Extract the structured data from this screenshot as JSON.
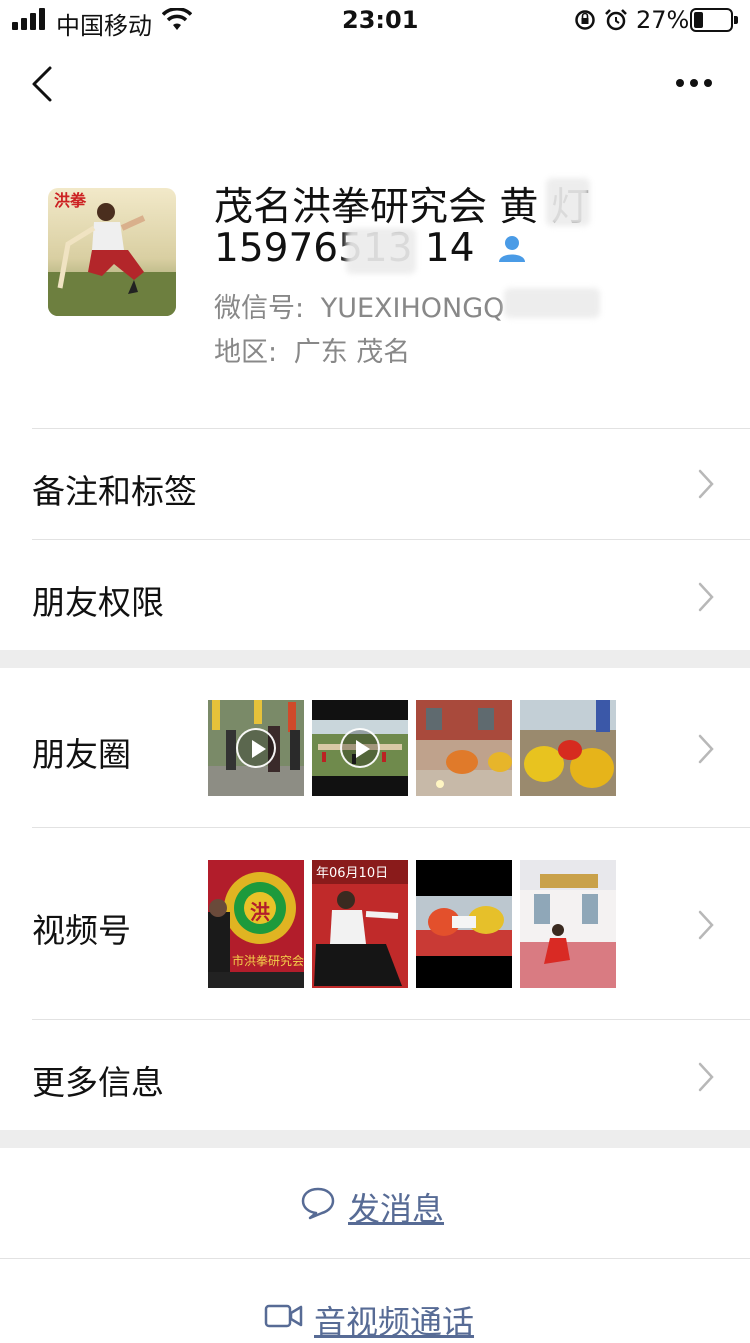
{
  "status_bar": {
    "carrier": "中国移动",
    "time": "23:01",
    "battery_percent": "27%",
    "battery_level": 0.27
  },
  "nav": {
    "back_icon": "chevron-left-icon",
    "more_icon": "more-horizontal-icon"
  },
  "profile": {
    "name": "茂名洪拳研究会 黄  灯",
    "phone": "15976513 14",
    "wechat_id_label": "微信号:",
    "wechat_id": "YUEXIHONGQ",
    "region_label": "地区:",
    "region": "广东 茂名",
    "avatar_text": "洪拳",
    "contact_icon": "contact-person-icon",
    "accent_color": "#4a9be6"
  },
  "rows": {
    "remarks": "备注和标签",
    "permissions": "朋友权限",
    "moments": "朋友圈",
    "channels": "视频号",
    "more_info": "更多信息"
  },
  "channels_thumbs": {
    "thumb1_badge": "洪",
    "thumb1_caption": "市洪拳研究会",
    "thumb2_caption": "年06月10日"
  },
  "actions": {
    "send_message": "发消息",
    "video_call": "音视频通话",
    "message_icon": "chat-bubble-icon",
    "video_icon": "video-camera-icon",
    "link_color": "#576b95"
  }
}
